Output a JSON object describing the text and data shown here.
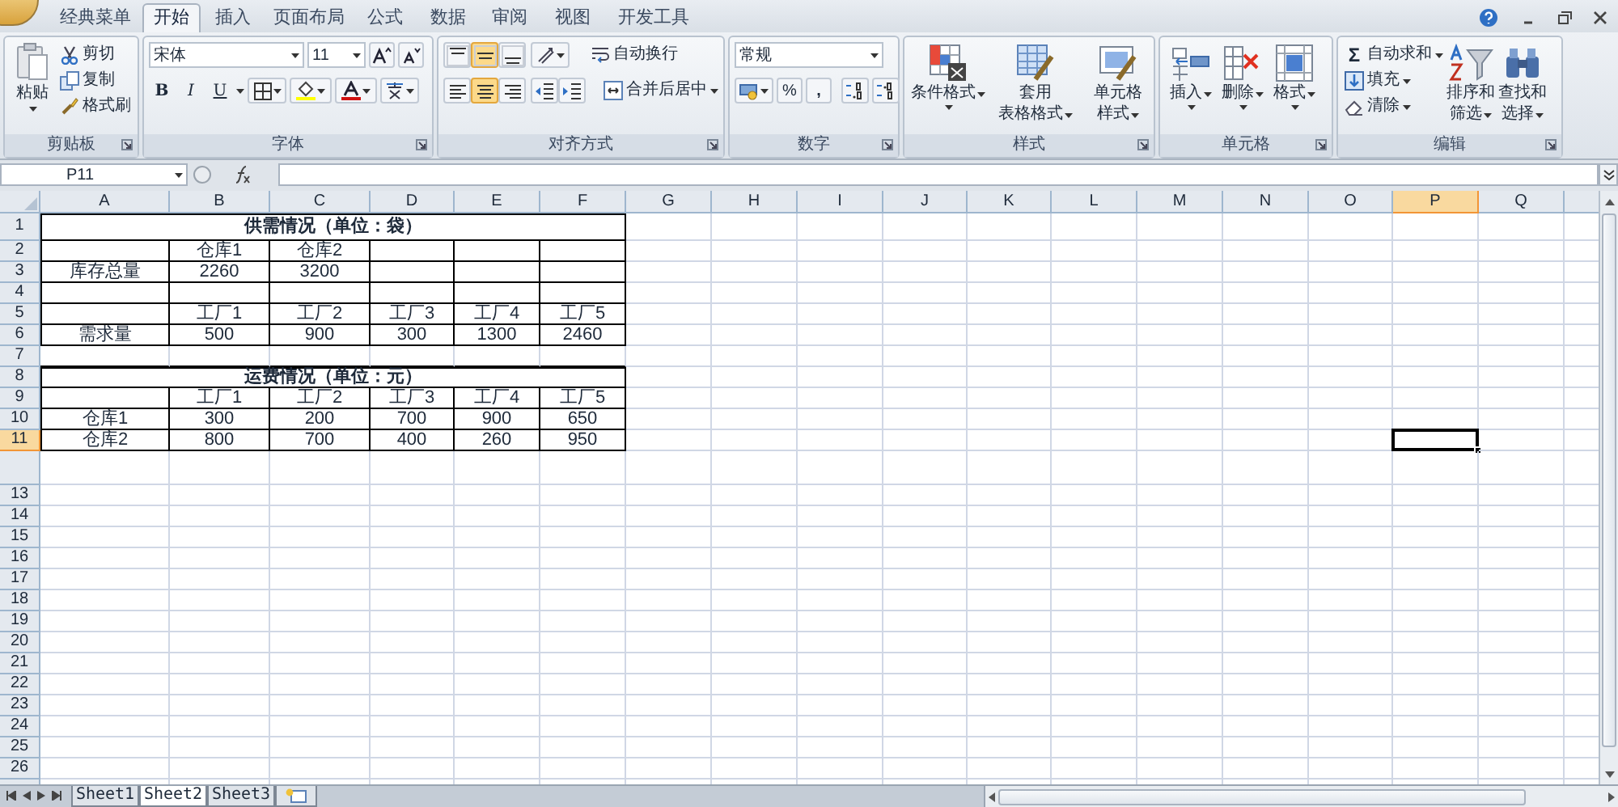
{
  "tabs": [
    {
      "label": "经典菜单",
      "selected": false
    },
    {
      "label": "开始",
      "selected": true
    },
    {
      "label": "插入",
      "selected": false
    },
    {
      "label": "页面布局",
      "selected": false
    },
    {
      "label": "公式",
      "selected": false
    },
    {
      "label": "数据",
      "selected": false
    },
    {
      "label": "审阅",
      "selected": false
    },
    {
      "label": "视图",
      "selected": false
    },
    {
      "label": "开发工具",
      "selected": false
    }
  ],
  "ribbon": {
    "clipboard": {
      "title": "剪贴板",
      "paste": "粘贴",
      "actions": [
        "剪切",
        "复制",
        "格式刷"
      ]
    },
    "font": {
      "title": "字体",
      "font_name": "宋体",
      "font_size": "11",
      "styles": [
        "B",
        "I",
        "U"
      ]
    },
    "alignment": {
      "title": "对齐方式",
      "vertical": [
        {
          "selected": false
        },
        {
          "selected": true
        },
        {
          "selected": false
        }
      ],
      "horizontal": [
        {
          "selected": false
        },
        {
          "selected": true
        },
        {
          "selected": false
        }
      ],
      "wrap_text": "自动换行",
      "merge_center": "合并后居中"
    },
    "number": {
      "title": "数字",
      "format": "常规",
      "percent": "%",
      "comma": ","
    },
    "styles": {
      "title": "样式",
      "buttons": [
        {
          "lines": [
            "条件格式"
          ]
        },
        {
          "lines": [
            "套用",
            "表格格式"
          ]
        },
        {
          "lines": [
            "单元格",
            "样式"
          ]
        }
      ]
    },
    "cells": {
      "title": "单元格",
      "buttons": [
        "插入",
        "删除",
        "格式"
      ]
    },
    "editing": {
      "title": "编辑",
      "sum_sign": "Σ",
      "actions": [
        "自动求和",
        "填充",
        "清除"
      ],
      "buttons": [
        {
          "lines": [
            "排序和",
            "筛选"
          ]
        },
        {
          "lines": [
            "查找和",
            "选择"
          ]
        }
      ]
    }
  },
  "formula_bar": {
    "name_box": "P11"
  },
  "sheet": {
    "columns": [
      {
        "label": "A",
        "selected": false
      },
      {
        "label": "B",
        "selected": false
      },
      {
        "label": "C",
        "selected": false
      },
      {
        "label": "D",
        "selected": false
      },
      {
        "label": "E",
        "selected": false
      },
      {
        "label": "F",
        "selected": false
      },
      {
        "label": "G",
        "selected": false
      },
      {
        "label": "H",
        "selected": false
      },
      {
        "label": "I",
        "selected": false
      },
      {
        "label": "J",
        "selected": false
      },
      {
        "label": "K",
        "selected": false
      },
      {
        "label": "L",
        "selected": false
      },
      {
        "label": "M",
        "selected": false
      },
      {
        "label": "N",
        "selected": false
      },
      {
        "label": "O",
        "selected": false
      },
      {
        "label": "P",
        "selected": true
      },
      {
        "label": "Q",
        "selected": false
      }
    ],
    "rows": [
      {
        "label": "1",
        "selected": false,
        "bordered": true,
        "title": "供需情况（单位：袋）"
      },
      {
        "label": "2",
        "selected": false,
        "bordered": true,
        "cells": {
          "B": "仓库1",
          "C": "仓库2"
        }
      },
      {
        "label": "3",
        "selected": false,
        "bordered": true,
        "cells": {
          "A": "库存总量",
          "B": "2260",
          "C": "3200"
        }
      },
      {
        "label": "4",
        "selected": false,
        "bordered": true
      },
      {
        "label": "5",
        "selected": false,
        "bordered": true,
        "cells": {
          "B": "工厂1",
          "C": "工厂2",
          "D": "工厂3",
          "E": "工厂4",
          "F": "工厂5"
        }
      },
      {
        "label": "6",
        "selected": false,
        "bordered": true,
        "cells": {
          "A": "需求量",
          "B": "500",
          "C": "900",
          "D": "300",
          "E": "1300",
          "F": "2460"
        }
      },
      {
        "label": "7",
        "selected": false,
        "bordered": false
      },
      {
        "label": "8",
        "selected": false,
        "bordered": true,
        "title": "运费情况（单位：元）"
      },
      {
        "label": "9",
        "selected": false,
        "bordered": true,
        "cells": {
          "B": "工厂1",
          "C": "工厂2",
          "D": "工厂3",
          "E": "工厂4",
          "F": "工厂5"
        }
      },
      {
        "label": "10",
        "selected": false,
        "bordered": true,
        "cells": {
          "A": "仓库1",
          "B": "300",
          "C": "200",
          "D": "700",
          "E": "900",
          "F": "650"
        }
      },
      {
        "label": "11",
        "selected": true,
        "bordered": true,
        "cells": {
          "A": "仓库2",
          "B": "800",
          "C": "700",
          "D": "400",
          "E": "260",
          "F": "950"
        }
      },
      {
        "selected": false,
        "bordered": false
      },
      {
        "label": "13",
        "selected": false,
        "bordered": false
      },
      {
        "label": "14",
        "selected": false,
        "bordered": false
      },
      {
        "label": "15",
        "selected": false,
        "bordered": false
      },
      {
        "label": "16",
        "selected": false,
        "bordered": false
      },
      {
        "label": "17",
        "selected": false,
        "bordered": false
      },
      {
        "label": "18",
        "selected": false,
        "bordered": false
      },
      {
        "label": "19",
        "selected": false,
        "bordered": false
      },
      {
        "label": "20",
        "selected": false,
        "bordered": false
      },
      {
        "label": "21",
        "selected": false,
        "bordered": false
      },
      {
        "label": "22",
        "selected": false,
        "bordered": false
      },
      {
        "label": "23",
        "selected": false,
        "bordered": false
      },
      {
        "label": "24",
        "selected": false,
        "bordered": false
      },
      {
        "label": "25",
        "selected": false,
        "bordered": false
      },
      {
        "label": "26",
        "selected": false,
        "bordered": false
      }
    ],
    "sheet_tabs": [
      {
        "label": "Sheet1",
        "selected": false
      },
      {
        "label": "Sheet2",
        "selected": true
      },
      {
        "label": "Sheet3",
        "selected": false
      }
    ]
  }
}
